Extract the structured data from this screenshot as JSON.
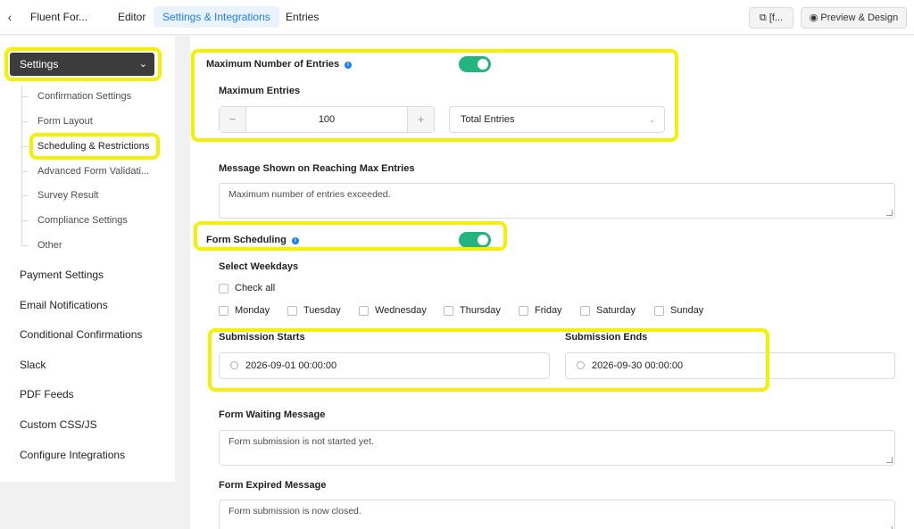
{
  "header": {
    "back_icon": "chevron-left-icon",
    "app_title": "Fluent For...",
    "tabs": [
      {
        "label": "Editor"
      },
      {
        "label": "Settings & Integrations"
      },
      {
        "label": "Entries"
      }
    ],
    "shortcode_button": "[f...",
    "preview_button": "Preview & Design"
  },
  "sidebar": {
    "settings_label": "Settings",
    "sub_items": [
      {
        "label": "Confirmation Settings"
      },
      {
        "label": "Form Layout"
      },
      {
        "label": "Scheduling & Restrictions"
      },
      {
        "label": "Advanced Form Validati..."
      },
      {
        "label": "Survey Result"
      },
      {
        "label": "Compliance Settings"
      },
      {
        "label": "Other"
      }
    ],
    "items": [
      {
        "label": "Payment Settings"
      },
      {
        "label": "Email Notifications"
      },
      {
        "label": "Conditional Confirmations"
      },
      {
        "label": "Slack"
      },
      {
        "label": "PDF Feeds"
      },
      {
        "label": "Custom CSS/JS"
      },
      {
        "label": "Configure Integrations"
      }
    ]
  },
  "max_entries": {
    "title": "Maximum Number of Entries",
    "enabled": true,
    "field_label": "Maximum Entries",
    "value": "100",
    "minus": "−",
    "plus": "+",
    "period": "Total Entries",
    "message_label": "Message Shown on Reaching Max Entries",
    "message": "Maximum number of entries exceeded."
  },
  "scheduling": {
    "title": "Form Scheduling",
    "enabled": true,
    "weekdays_label": "Select Weekdays",
    "check_all": "Check all",
    "weekdays": [
      "Monday",
      "Tuesday",
      "Wednesday",
      "Thursday",
      "Friday",
      "Saturday",
      "Sunday"
    ],
    "start_label": "Submission Starts",
    "start_value": "2026-09-01 00:00:00",
    "end_label": "Submission Ends",
    "end_value": "2026-09-30 00:00:00",
    "waiting_label": "Form Waiting Message",
    "waiting_message": "Form submission is not started yet.",
    "expired_label": "Form Expired Message",
    "expired_message": "Form submission is now closed."
  },
  "colors": {
    "accent": "#1a7efb",
    "toggle_on": "#24b47e",
    "highlight": "#f5ef00",
    "sidebar_active": "#3c3c3c"
  }
}
